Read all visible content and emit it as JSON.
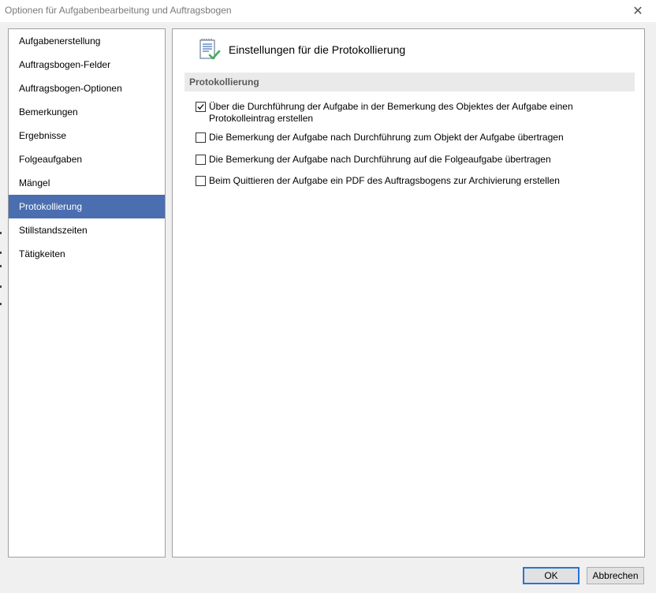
{
  "window": {
    "title": "Optionen für Aufgabenbearbeitung und Auftragsbogen",
    "close_glyph": "✕"
  },
  "sidebar": {
    "items": [
      {
        "label": "Aufgabenerstellung",
        "selected": false
      },
      {
        "label": "Auftragsbogen-Felder",
        "selected": false
      },
      {
        "label": "Auftragsbogen-Optionen",
        "selected": false
      },
      {
        "label": "Bemerkungen",
        "selected": false
      },
      {
        "label": "Ergebnisse",
        "selected": false
      },
      {
        "label": "Folgeaufgaben",
        "selected": false
      },
      {
        "label": "Mängel",
        "selected": false
      },
      {
        "label": "Protokollierung",
        "selected": true
      },
      {
        "label": "Stillstandszeiten",
        "selected": false
      },
      {
        "label": "Tätigkeiten",
        "selected": false
      }
    ],
    "selected_color": "#4a6eb0"
  },
  "main": {
    "header_icon": "checklist-document-icon",
    "header_title": "Einstellungen für die Protokollierung",
    "section_title": "Protokollierung",
    "options": [
      {
        "label_line1": "Über die Durchführung der Aufgabe in der Bemerkung des Objektes der Aufgabe einen",
        "label_line2": "Protokolleintrag erstellen",
        "checked": true
      },
      {
        "label_line1": "Die Bemerkung der Aufgabe nach Durchführung zum Objekt der Aufgabe übertragen",
        "label_line2": "",
        "checked": false
      },
      {
        "label_line1": "Die Bemerkung der Aufgabe nach Durchführung auf die Folgeaufgabe übertragen",
        "label_line2": "",
        "checked": false
      },
      {
        "label_line1": "Beim Quittieren der Aufgabe ein PDF des Auftragsbogens zur Archivierung erstellen",
        "label_line2": "",
        "checked": false
      }
    ]
  },
  "footer": {
    "ok_label": "OK",
    "cancel_label": "Abbrechen"
  }
}
